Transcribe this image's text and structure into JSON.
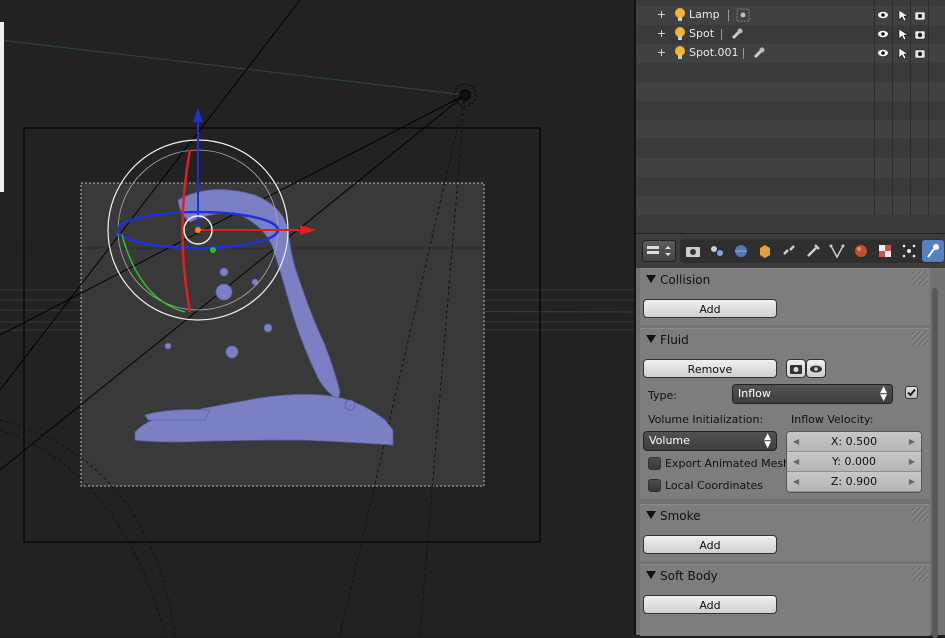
{
  "outliner": {
    "rows": [
      {
        "name": "Lamp",
        "expand": "+",
        "bulb_color": "#f5b335"
      },
      {
        "name": "Spot",
        "expand": "+",
        "bulb_color": "#f5b335"
      },
      {
        "name": "Spot.001",
        "expand": "+",
        "bulb_color": "#f5b335"
      }
    ]
  },
  "properties": {
    "tabs": [
      "render-icon",
      "render-layers-icon",
      "scene-icon",
      "world-icon",
      "object-icon",
      "constraints-icon",
      "modifiers-icon",
      "data-icon",
      "material-icon",
      "texture-icon",
      "particles-icon",
      "physics-icon"
    ],
    "active_tab": "physics-icon",
    "collision": {
      "title": "Collision",
      "add_label": "Add"
    },
    "fluid": {
      "title": "Fluid",
      "remove_label": "Remove",
      "type_label": "Type:",
      "type_value": "Inflow",
      "volume_init_label": "Volume Initialization:",
      "volume_init_value": "Volume",
      "inflow_velocity_label": "Inflow Velocity:",
      "export_mesh_label": "Export Animated Mesh",
      "local_coords_label": "Local Coordinates",
      "velocity": {
        "x": "X: 0.500",
        "y": "Y: 0.000",
        "z": "Z: 0.900"
      }
    },
    "smoke": {
      "title": "Smoke",
      "add_label": "Add"
    },
    "soft_body": {
      "title": "Soft Body",
      "add_label": "Add"
    }
  },
  "colors": {
    "viewport_bg": "#222222",
    "mesh": "#7b80c4",
    "panel_bg": "#7d7d7d",
    "active_tab": "#5680c2",
    "axis_x": "#e02020",
    "axis_y": "#2bc32b",
    "axis_z": "#2030d8"
  }
}
